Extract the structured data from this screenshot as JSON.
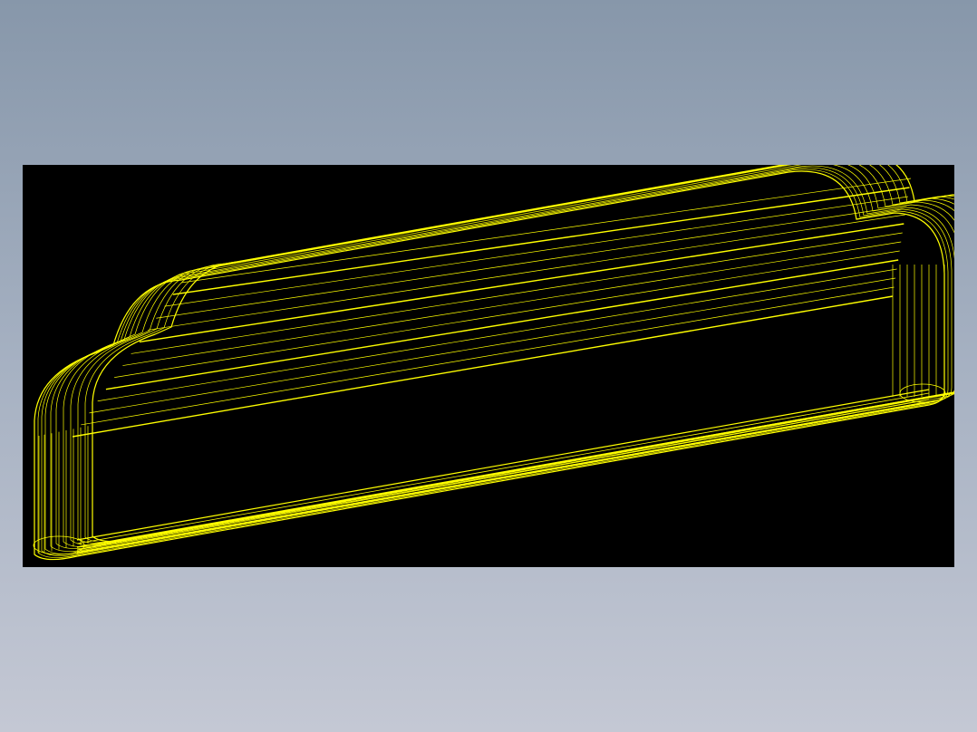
{
  "scene": {
    "view_mode": "wireframe",
    "object": "rounded-bar-profile-part",
    "background_color": "#000000",
    "wire_color": "#ffff00"
  }
}
